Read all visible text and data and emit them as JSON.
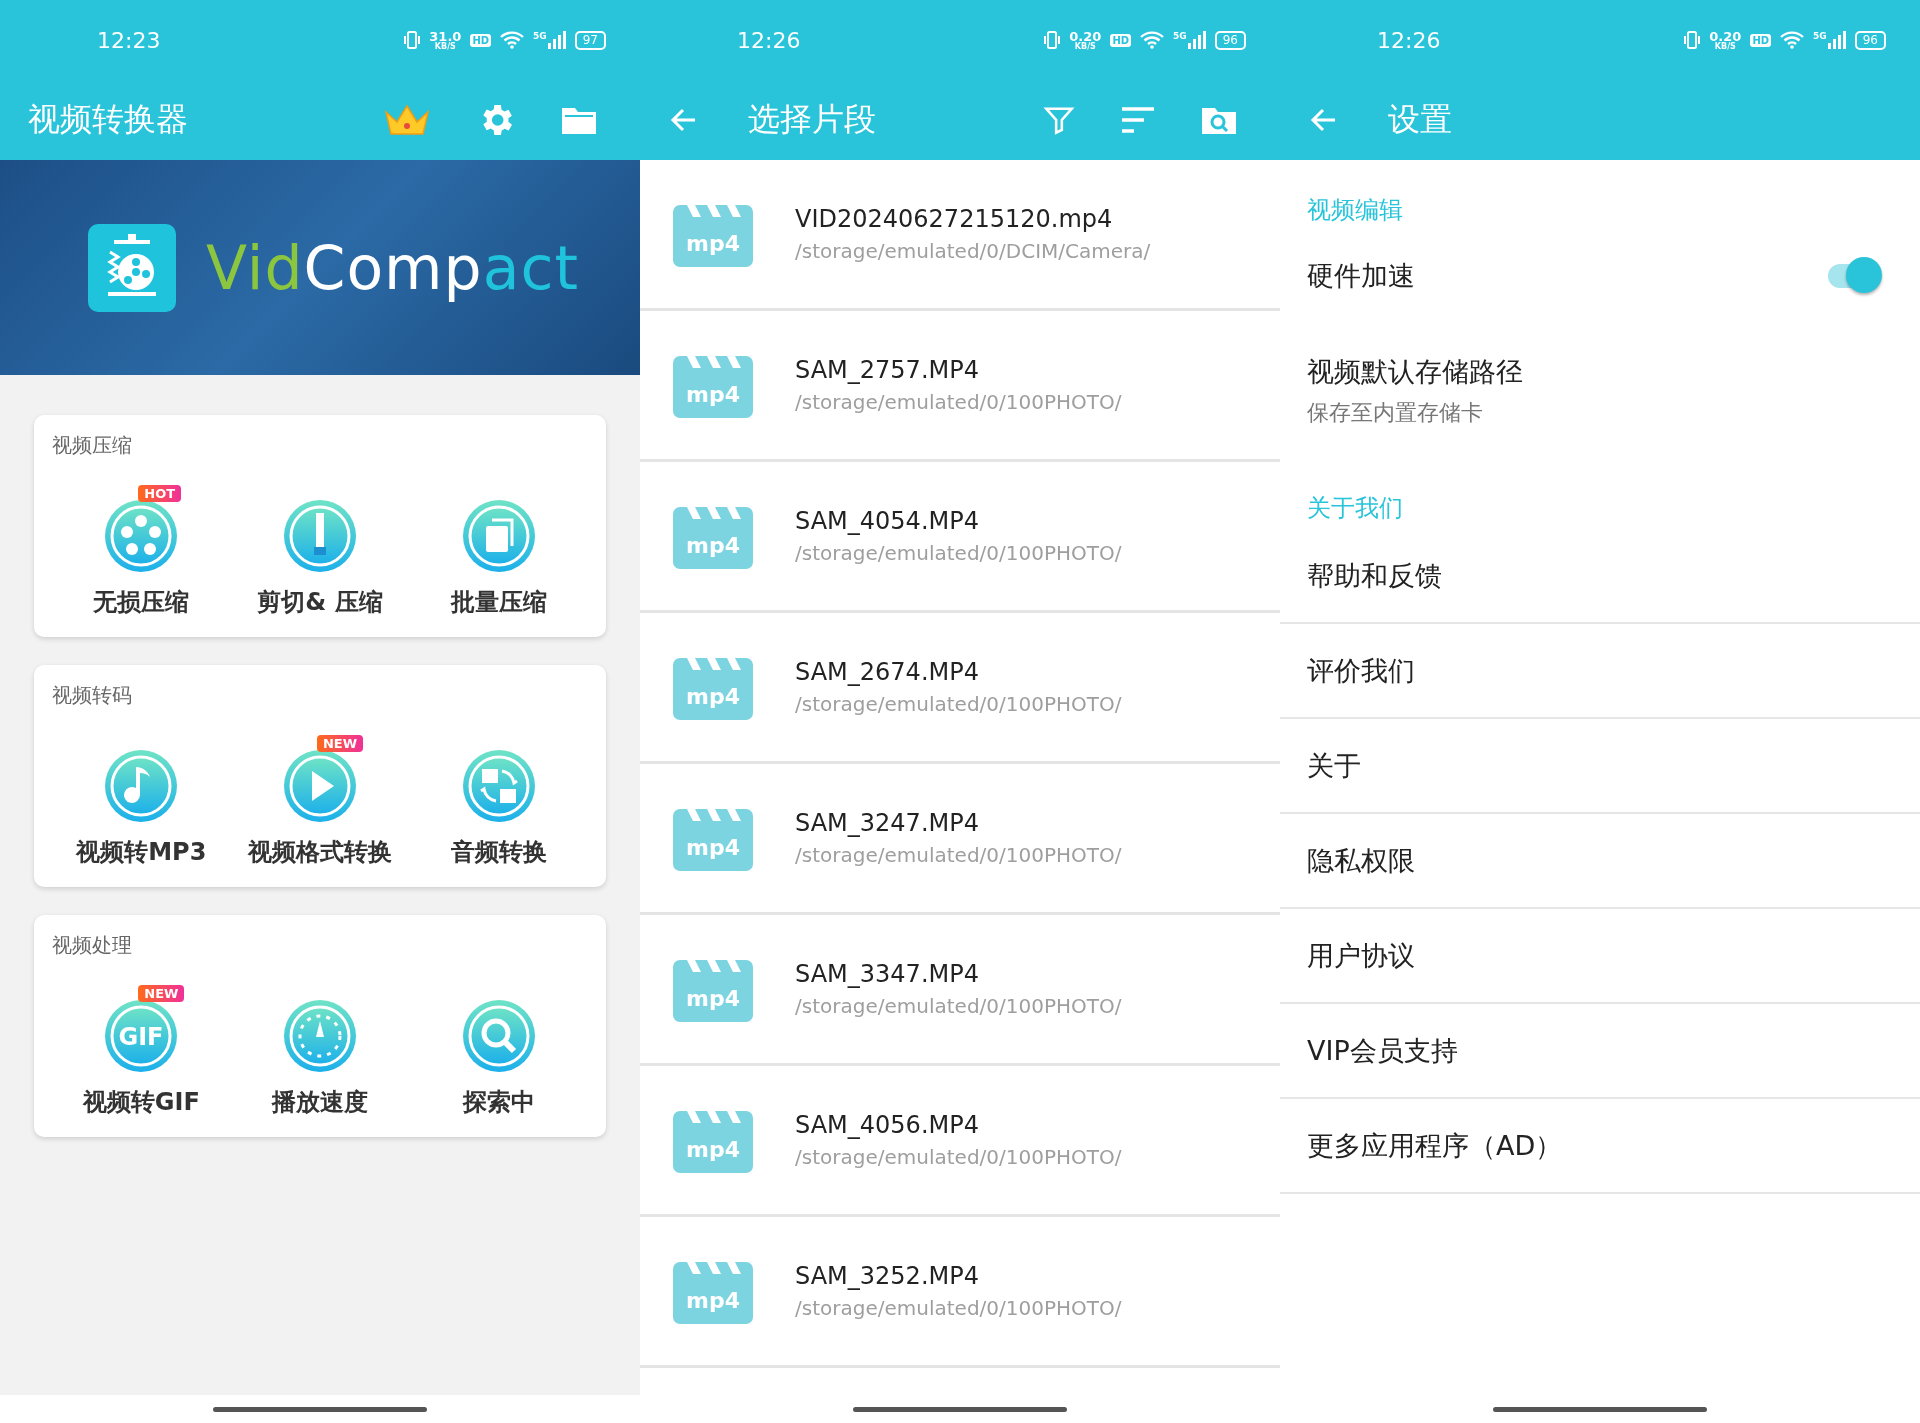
{
  "home": {
    "status_bar": {
      "time": "12:23",
      "speed": "31.0",
      "speed_unit": "KB/S",
      "hd": "HD",
      "network": "5G",
      "battery": "97"
    },
    "app_bar": {
      "title": "视频转换器"
    },
    "banner": {
      "logo_segments": [
        {
          "text": "Vid",
          "color": "#8cc63f"
        },
        {
          "text": "Comp",
          "color": "#ffffff"
        },
        {
          "text": "act",
          "color": "#1fc3dc"
        }
      ]
    },
    "cards": [
      {
        "title": "视频压缩",
        "tools": [
          {
            "label": "无损压缩",
            "kind": "film",
            "badge": "HOT"
          },
          {
            "label": "剪切& 压缩",
            "kind": "zip"
          },
          {
            "label": "批量压缩",
            "kind": "copy"
          }
        ]
      },
      {
        "title": "视频转码",
        "tools": [
          {
            "label": "视频转MP3",
            "kind": "music"
          },
          {
            "label": "视频格式转换",
            "kind": "play",
            "badge": "NEW"
          },
          {
            "label": "音频转换",
            "kind": "convert"
          }
        ]
      },
      {
        "title": "视频处理",
        "tools": [
          {
            "label": "视频转GIF",
            "kind": "gif",
            "badge": "NEW",
            "icon_text": "GIF"
          },
          {
            "label": "播放速度",
            "kind": "speed"
          },
          {
            "label": "探索中",
            "kind": "search"
          }
        ]
      }
    ]
  },
  "clip_picker": {
    "status_bar": {
      "time": "12:26",
      "speed": "0.20",
      "speed_unit": "KB/S",
      "hd": "HD",
      "network": "5G",
      "battery": "96"
    },
    "app_bar": {
      "title": "选择片段"
    },
    "files": [
      {
        "name": "VID20240627215120.mp4",
        "path": "/storage/emulated/0/DCIM/Camera/",
        "icon_text": "mp4"
      },
      {
        "name": "SAM_2757.MP4",
        "path": "/storage/emulated/0/100PHOTO/",
        "icon_text": "mp4"
      },
      {
        "name": "SAM_4054.MP4",
        "path": "/storage/emulated/0/100PHOTO/",
        "icon_text": "mp4"
      },
      {
        "name": "SAM_2674.MP4",
        "path": "/storage/emulated/0/100PHOTO/",
        "icon_text": "mp4"
      },
      {
        "name": "SAM_3247.MP4",
        "path": "/storage/emulated/0/100PHOTO/",
        "icon_text": "mp4"
      },
      {
        "name": "SAM_3347.MP4",
        "path": "/storage/emulated/0/100PHOTO/",
        "icon_text": "mp4"
      },
      {
        "name": "SAM_4056.MP4",
        "path": "/storage/emulated/0/100PHOTO/",
        "icon_text": "mp4"
      },
      {
        "name": "SAM_3252.MP4",
        "path": "/storage/emulated/0/100PHOTO/",
        "icon_text": "mp4"
      }
    ]
  },
  "settings": {
    "status_bar": {
      "time": "12:26",
      "speed": "0.20",
      "speed_unit": "KB/S",
      "hd": "HD",
      "network": "5G",
      "battery": "96"
    },
    "app_bar": {
      "title": "设置"
    },
    "sections": [
      {
        "header": "视频编辑",
        "items": [
          {
            "kind": "toggle",
            "label": "硬件加速",
            "on": true
          },
          {
            "kind": "detail",
            "label": "视频默认存储路径",
            "subtitle": "保存至内置存储卡"
          }
        ]
      },
      {
        "header": "关于我们",
        "items": [
          {
            "kind": "link",
            "label": "帮助和反馈"
          },
          {
            "kind": "link",
            "label": "评价我们"
          },
          {
            "kind": "link",
            "label": "关于"
          },
          {
            "kind": "link",
            "label": "隐私权限"
          },
          {
            "kind": "link",
            "label": "用户协议"
          },
          {
            "kind": "link",
            "label": "VIP会员支持"
          },
          {
            "kind": "link",
            "label": "更多应用程序（AD）"
          }
        ]
      }
    ]
  }
}
